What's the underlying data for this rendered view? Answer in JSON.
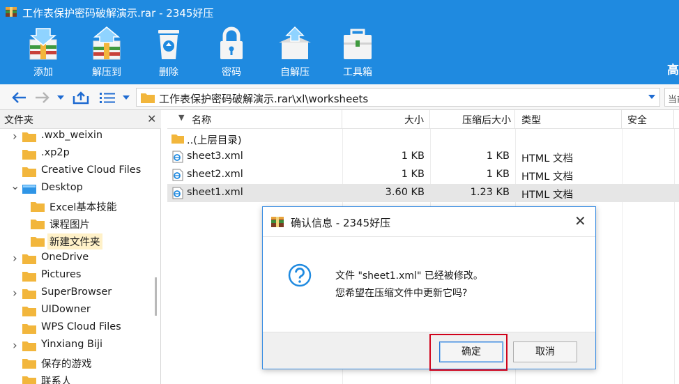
{
  "window": {
    "title": "工作表保护密码破解演示.rar - 2345好压",
    "edge_text": "高"
  },
  "toolbar": {
    "items": [
      {
        "label": "添加",
        "icon": "add-archive-icon"
      },
      {
        "label": "解压到",
        "icon": "extract-icon"
      },
      {
        "label": "删除",
        "icon": "recycle-bin-icon"
      },
      {
        "label": "密码",
        "icon": "lock-icon"
      },
      {
        "label": "自解压",
        "icon": "self-extract-icon"
      },
      {
        "label": "工具箱",
        "icon": "toolbox-icon"
      }
    ]
  },
  "address": {
    "path": "工作表保护密码破解演示.rar\\xl\\worksheets",
    "right_stub": "当前"
  },
  "folders": {
    "header": "文件夹",
    "items": [
      {
        "label": ".wxb_weixin",
        "expandable": true
      },
      {
        "label": ".xp2p",
        "expandable": false
      },
      {
        "label": "Creative Cloud Files",
        "expandable": false
      },
      {
        "label": "Desktop",
        "expandable": true,
        "expanded": true
      },
      {
        "label": "Excel基本技能",
        "expandable": false
      },
      {
        "label": "课程图片",
        "expandable": false
      },
      {
        "label": "新建文件夹",
        "expandable": false,
        "selected": true
      },
      {
        "label": "OneDrive",
        "expandable": true
      },
      {
        "label": "Pictures",
        "expandable": false
      },
      {
        "label": "SuperBrowser",
        "expandable": true
      },
      {
        "label": "UIDowner",
        "expandable": false
      },
      {
        "label": "WPS Cloud Files",
        "expandable": false
      },
      {
        "label": "Yinxiang Biji",
        "expandable": true
      },
      {
        "label": "保存的游戏",
        "expandable": false
      },
      {
        "label": "联系人",
        "expandable": false
      }
    ]
  },
  "file_list": {
    "columns": [
      "名称",
      "大小",
      "压缩后大小",
      "类型",
      "安全"
    ],
    "rows": [
      {
        "name": "..(上层目录)",
        "size": "",
        "packed": "",
        "type": "",
        "kind": "folder"
      },
      {
        "name": "sheet3.xml",
        "size": "1 KB",
        "packed": "1 KB",
        "type": "HTML 文档",
        "kind": "xml"
      },
      {
        "name": "sheet2.xml",
        "size": "1 KB",
        "packed": "1 KB",
        "type": "HTML 文档",
        "kind": "xml"
      },
      {
        "name": "sheet1.xml",
        "size": "3.60 KB",
        "packed": "1.23 KB",
        "type": "HTML 文档",
        "kind": "xml",
        "selected": true
      }
    ]
  },
  "dialog": {
    "title": "确认信息 - 2345好压",
    "message_line1": "文件 \"sheet1.xml\" 已经被修改。",
    "message_line2": "您希望在压缩文件中更新它吗?",
    "ok_label": "确定",
    "cancel_label": "取消"
  }
}
